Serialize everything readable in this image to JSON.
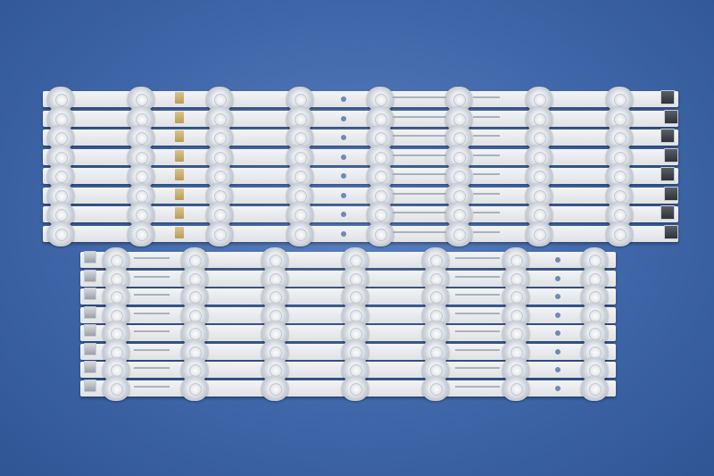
{
  "photo": {
    "background_color": "#3f66a8",
    "strip_color": "#e6e8eb",
    "upper_strip_count": 8,
    "lower_strip_count": 8,
    "lenses_per_upper_strip": 8,
    "lenses_per_lower_strip": 7
  }
}
